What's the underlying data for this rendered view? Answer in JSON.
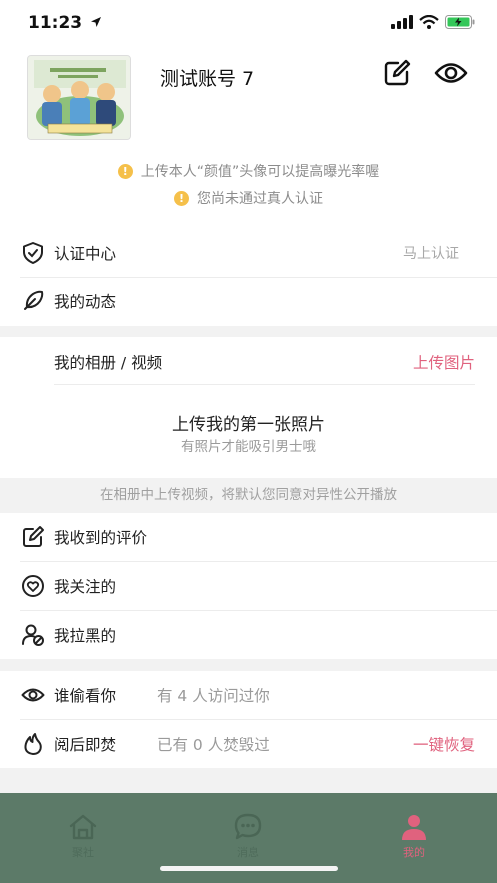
{
  "status_bar": {
    "time": "11:23"
  },
  "profile": {
    "username": "测试账号 7"
  },
  "tips": [
    "上传本人“颜值”头像可以提高曝光率喔",
    "您尚未通过真人认证"
  ],
  "menu_top": [
    {
      "label": "认证中心",
      "right": "马上认证"
    },
    {
      "label": "我的动态"
    }
  ],
  "album": {
    "title": "我的相册 / 视频",
    "upload_label": "上传图片",
    "empty_title": "上传我的第一张照片",
    "empty_subtitle": "有照片才能吸引男士哦",
    "notice": "在相册中上传视频，将默认您同意对异性公开播放"
  },
  "menu_mid": [
    {
      "label": "我收到的评价"
    },
    {
      "label": "我关注的"
    },
    {
      "label": "我拉黑的"
    }
  ],
  "menu_bottom": [
    {
      "label": "谁偷看你",
      "sub": "有 4 人访问过你"
    },
    {
      "label": "阅后即焚",
      "sub": "已有 0 人焚毁过",
      "action": "一键恢复"
    }
  ],
  "tabbar": [
    {
      "label": "聚社",
      "icon": "home-icon"
    },
    {
      "label": "消息",
      "icon": "chat-icon"
    },
    {
      "label": "我的",
      "icon": "user-icon",
      "active": true
    }
  ],
  "colors": {
    "accent_pink": "#e0627e",
    "tabbar_bg": "#5c7a68",
    "warning_yellow": "#f5c04a"
  }
}
